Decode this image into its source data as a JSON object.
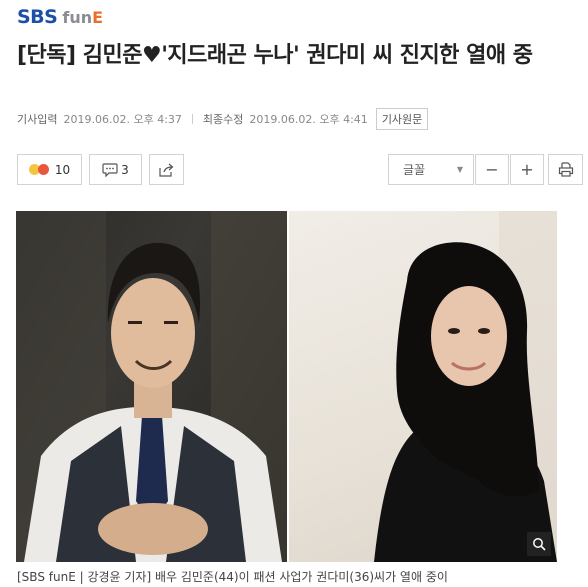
{
  "header": {
    "logo_sbs": "SBS",
    "logo_fun": "fun",
    "logo_e": "E",
    "brand_color": "#1b4fa8",
    "accent_color": "#e8702a"
  },
  "article": {
    "title": "[단독] 김민준♥'지드래곤 누나' 권다미 씨 진지한 열애 중",
    "meta": {
      "input_label": "기사입력",
      "input_time": "2019.06.02. 오후 4:37",
      "modified_label": "최종수정",
      "modified_time": "2019.06.02. 오후 4:41",
      "original_label": "기사원문"
    },
    "caption": "[SBS funE | 강경윤 기자] 배우 김민준(44)이 패션 사업가 권다미(36)씨가 열애 중이"
  },
  "toolbar": {
    "reaction_count": "10",
    "comment_count": "3",
    "share_icon": "share-icon",
    "font_label": "글꼴",
    "minus_label": "−",
    "plus_label": "+",
    "print_icon": "print-icon"
  },
  "photos": {
    "zoom_icon": "search-icon"
  }
}
